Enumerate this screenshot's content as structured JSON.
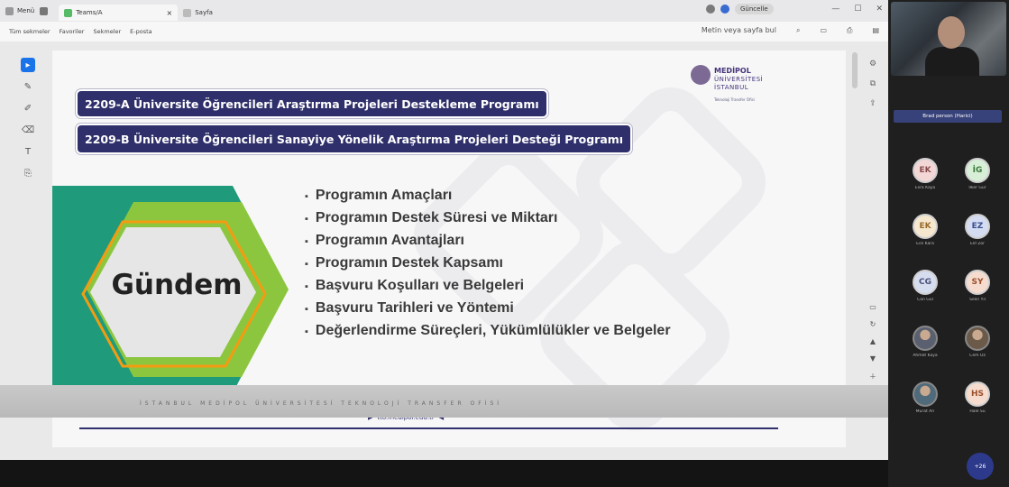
{
  "browser": {
    "tabbar": {
      "menu_label": "Menü",
      "tabs": [
        {
          "label": "Teams/A",
          "active": true
        },
        {
          "label": "Sayfa",
          "active": false
        }
      ],
      "profile_button": "Güncelle"
    },
    "bookmarks": [
      "Tüm sekmeler",
      "Favoriler",
      "Sekmeler",
      "E-posta"
    ],
    "toolbar_search": "Metin veya sayfa bul"
  },
  "slide": {
    "banner_a": "2209-A Üniversite Öğrencileri Araştırma Projeleri Destekleme Programı",
    "banner_b": "2209-B Üniversite Öğrencileri Sanayiye Yönelik Araştırma Projeleri Desteği Programı",
    "logo": {
      "line1": "MEDİPOL",
      "line2": "ÜNİVERSİTESİ",
      "line3": "İSTANBUL",
      "line4": "Teknoloji Transfer Ofisi"
    },
    "agenda_title": "Gündem",
    "agenda_items": [
      "Programın Amaçları",
      "Programın Destek Süresi ve Miktarı",
      "Programın Avantajları",
      "Programın Destek Kapsamı",
      "Başvuru Koşulları ve  Belgeleri",
      "Başvuru Tarihleri ve Yöntemi",
      "Değerlendirme Süreçleri, Yükümlülükler ve Belgeler"
    ],
    "link_text": "tto.medipol.edu.tr",
    "footer_text": "İSTANBUL MEDİPOL ÜNİVERSİTESİ TEKNOLOJİ TRANSFER OFİSİ"
  },
  "participants": {
    "speaker_label": "Brad person (Harici)",
    "tiles": [
      {
        "initials": "EK",
        "name": "Esra Kaya",
        "bg": "#f3d6d6",
        "fg": "#8a4a4a",
        "photo": false
      },
      {
        "initials": "İG",
        "name": "İlker Gür",
        "bg": "#d6efd6",
        "fg": "#3c7a3c",
        "photo": false
      },
      {
        "initials": "EK",
        "name": "Ece Kara",
        "bg": "#f6e8cf",
        "fg": "#9a6a2a",
        "photo": false
      },
      {
        "initials": "EZ",
        "name": "Elif Zor",
        "bg": "#d4dcf2",
        "fg": "#3a4f8f",
        "photo": false
      },
      {
        "initials": "CG",
        "name": "Can Gül",
        "bg": "#d6ddef",
        "fg": "#4a4f7a",
        "photo": false
      },
      {
        "initials": "SY",
        "name": "Selin Yıl",
        "bg": "#f6dccf",
        "fg": "#9a4f2a",
        "photo": false
      },
      {
        "initials": "",
        "name": "Ahmet Kaya",
        "bg": "#5a6070",
        "fg": "#fff",
        "photo": true
      },
      {
        "initials": "",
        "name": "Cem Öz",
        "bg": "#6b5a4a",
        "fg": "#fff",
        "photo": true
      },
      {
        "initials": "",
        "name": "Murat Arı",
        "bg": "#4f6a7a",
        "fg": "#fff",
        "photo": true
      },
      {
        "initials": "HS",
        "name": "Hale Su",
        "bg": "#f6dccf",
        "fg": "#9a4f2a",
        "photo": false
      }
    ],
    "more_label": "+26"
  }
}
